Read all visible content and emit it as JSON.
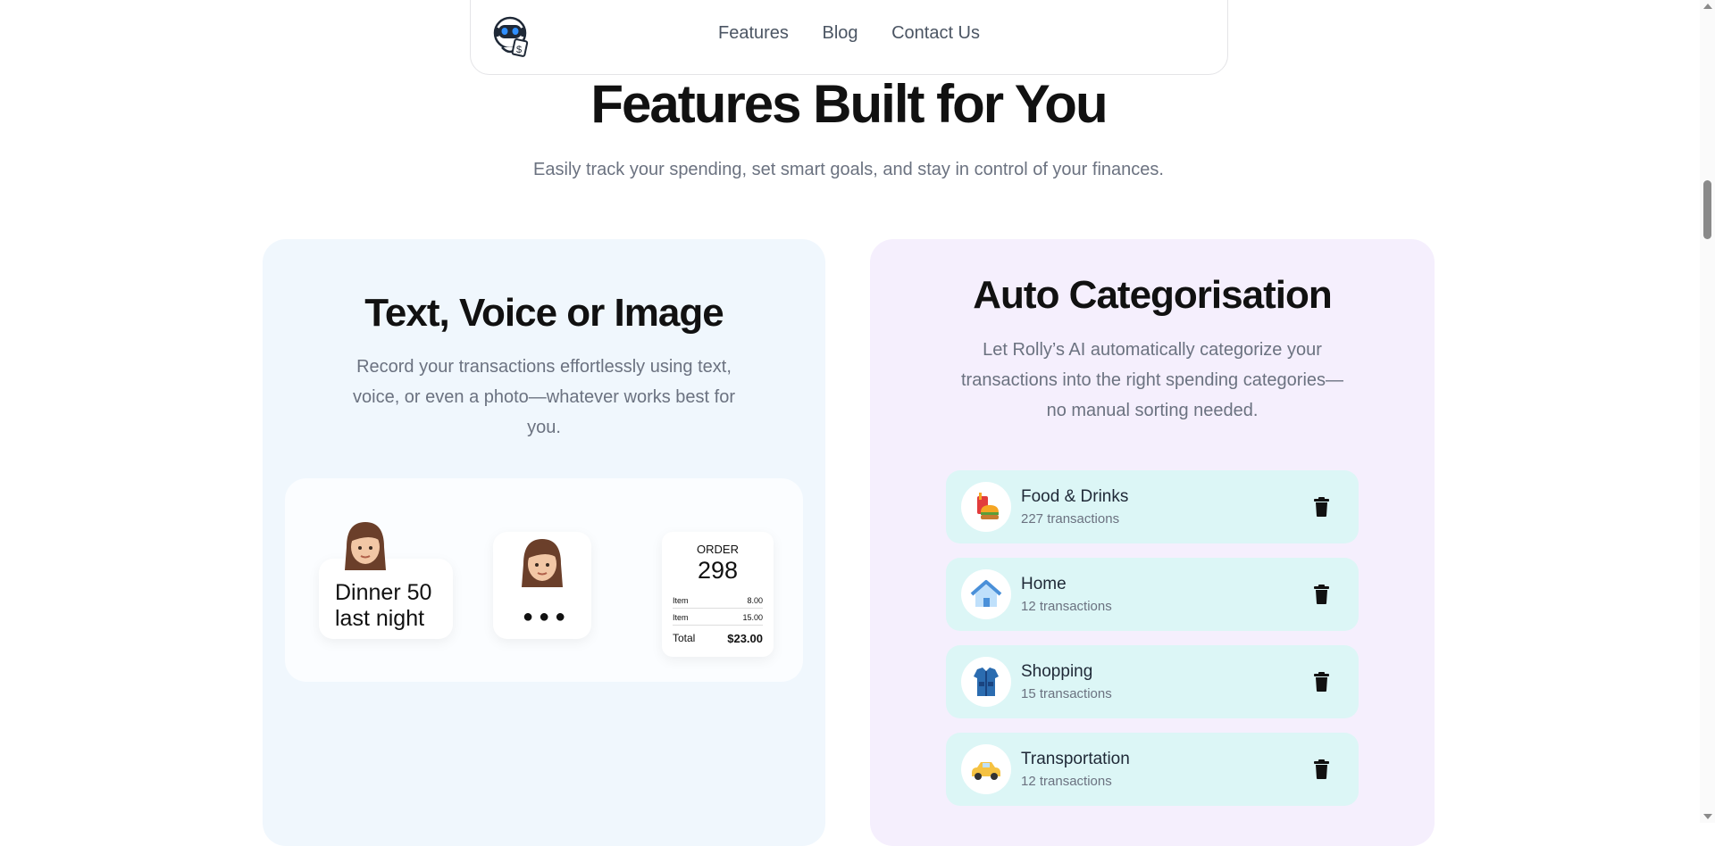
{
  "nav": {
    "links": [
      "Features",
      "Blog",
      "Contact Us"
    ]
  },
  "hero": {
    "title": "Features Built for You",
    "subtitle": "Easily track your spending, set smart goals, and stay in control of your finances."
  },
  "card_input": {
    "title": "Text, Voice or Image",
    "description": "Record your transactions effortlessly using text, voice, or even a photo—whatever works best for you.",
    "text_bubble": "Dinner 50 last night",
    "voice_indicator": "●●●",
    "receipt": {
      "header": "ORDER",
      "number": "298",
      "rows": [
        {
          "label": "Item",
          "value": "8.00"
        },
        {
          "label": "Item",
          "value": "15.00"
        }
      ],
      "total_label": "Total",
      "total_value": "$23.00"
    }
  },
  "card_categories": {
    "title": "Auto Categorisation",
    "description": "Let Rolly’s AI automatically categorize your transactions into the right spending categories—no manual sorting needed.",
    "items": [
      {
        "name": "Food & Drinks",
        "count": "227 transactions",
        "icon": "food-drinks-icon"
      },
      {
        "name": "Home",
        "count": "12 transactions",
        "icon": "home-icon"
      },
      {
        "name": "Shopping",
        "count": "15 transactions",
        "icon": "shopping-icon"
      },
      {
        "name": "Transportation",
        "count": "12 transactions",
        "icon": "car-icon"
      }
    ]
  },
  "colors": {
    "left_card_bg": "#f0f7fd",
    "right_card_bg": "#f5effd",
    "category_row_bg": "#dcf6f6"
  }
}
